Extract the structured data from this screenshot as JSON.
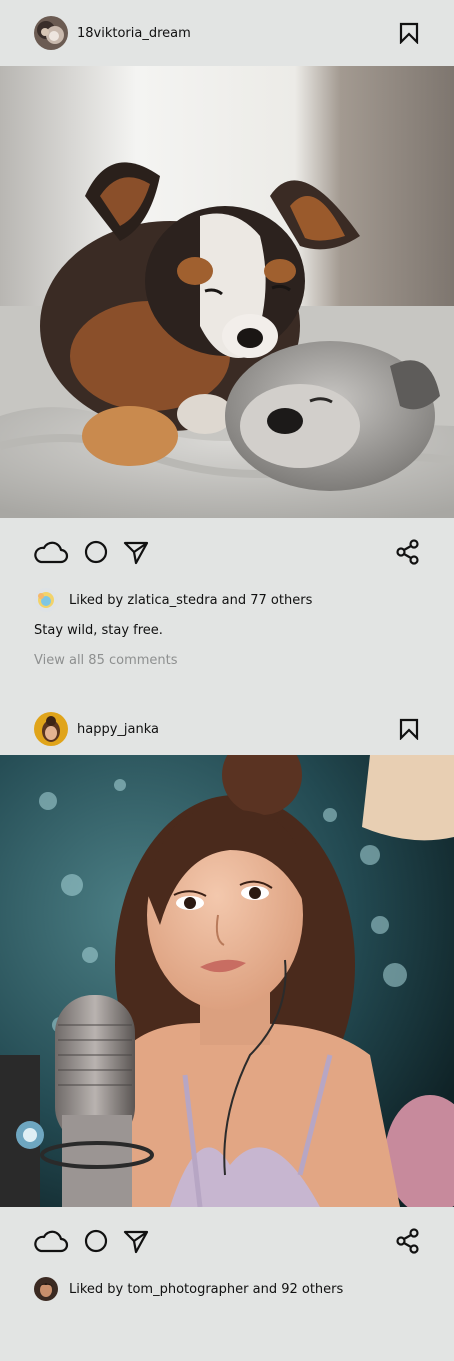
{
  "posts": [
    {
      "username": "18viktoria_dream",
      "photo_description_icon": "puppies-photo",
      "likes_text": "Liked by zlatica_stedra and 77 others",
      "caption": "Stay wild, stay free.",
      "comments_link": "View all 85 comments"
    },
    {
      "username": "happy_janka",
      "photo_description_icon": "woman-microphone-photo",
      "likes_text": "Liked by tom_photographer and 92 others"
    }
  ],
  "icons": {
    "like": "cloud-icon",
    "comment": "circle-icon",
    "send": "send-arrow-icon",
    "share": "share-icon",
    "save": "bookmark-icon"
  },
  "colors": {
    "background": "#e2e4e3",
    "muted_text": "#8e9090"
  }
}
